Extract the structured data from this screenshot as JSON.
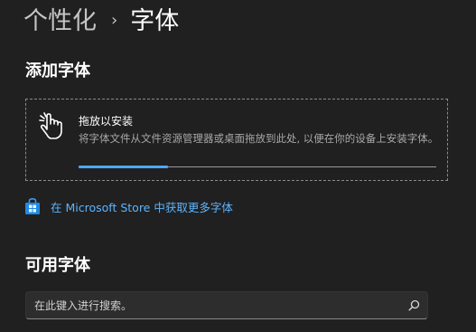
{
  "breadcrumb": {
    "parent": "个性化",
    "separator": "›",
    "current": "字体"
  },
  "add_fonts": {
    "title": "添加字体",
    "drop_title": "拖放以安装",
    "drop_description": "将字体文件从文件资源管理器或桌面拖放到此处, 以便在你的设备上安装字体。",
    "progress": 0.25,
    "icon": "drag-hand-icon"
  },
  "store_link": {
    "label": "在 Microsoft Store 中获取更多字体",
    "icon": "store-icon"
  },
  "available_fonts": {
    "title": "可用字体",
    "search_placeholder": "在此键入进行搜索。",
    "search_icon": "search-icon"
  },
  "colors": {
    "background": "#202020",
    "accent": "#4aa8ff",
    "link": "#5cb4ff"
  }
}
